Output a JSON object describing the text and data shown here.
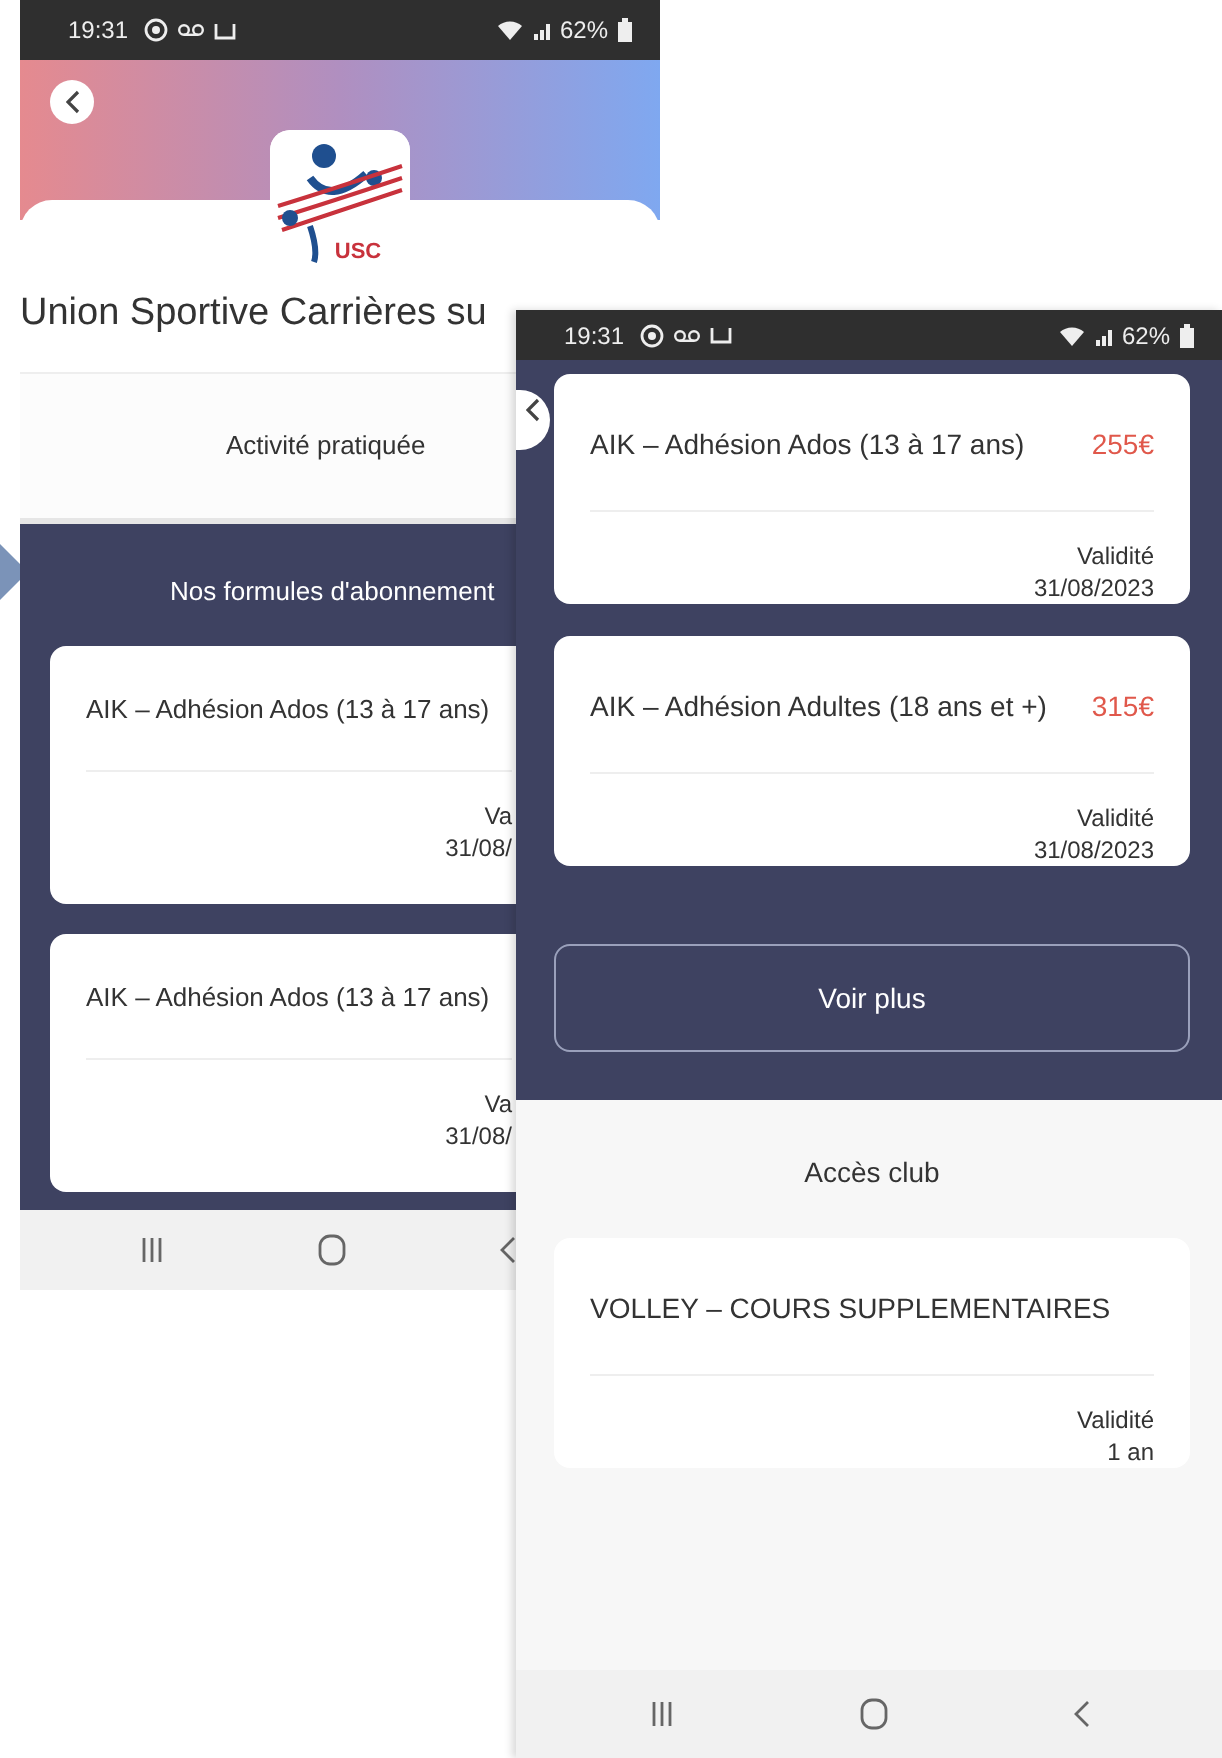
{
  "left_screen": {
    "status_bar": {
      "time": "19:31",
      "battery": "62%"
    },
    "logo_text": "USC",
    "club_title": "Union Sportive Carrières su",
    "activity_heading": "Activité pratiquée",
    "subscriptions_heading": "Nos formules d'abonnement",
    "subscriptions": [
      {
        "name": "AIK – Adhésion Ados (13 à 17 ans)",
        "validity_label": "Va",
        "validity": "31/08/"
      },
      {
        "name": "AIK – Adhésion Ados (13 à 17 ans)",
        "validity_label": "Va",
        "validity": "31/08/"
      }
    ]
  },
  "right_screen": {
    "status_bar": {
      "time": "19:31",
      "battery": "62%"
    },
    "subscriptions": [
      {
        "name": "AIK – Adhésion Ados (13 à 17 ans)",
        "price": "255€",
        "validity_label": "Validité",
        "validity": "31/08/2023"
      },
      {
        "name": "AIK – Adhésion Adultes (18 ans et +)",
        "price": "315€",
        "validity_label": "Validité",
        "validity": "31/08/2023"
      }
    ],
    "more_button": "Voir plus",
    "club_access_heading": "Accès club",
    "club_access": [
      {
        "name": "VOLLEY – COURS SUPPLEMENTAIRES",
        "validity_label": "Validité",
        "validity": "1 an"
      }
    ]
  }
}
